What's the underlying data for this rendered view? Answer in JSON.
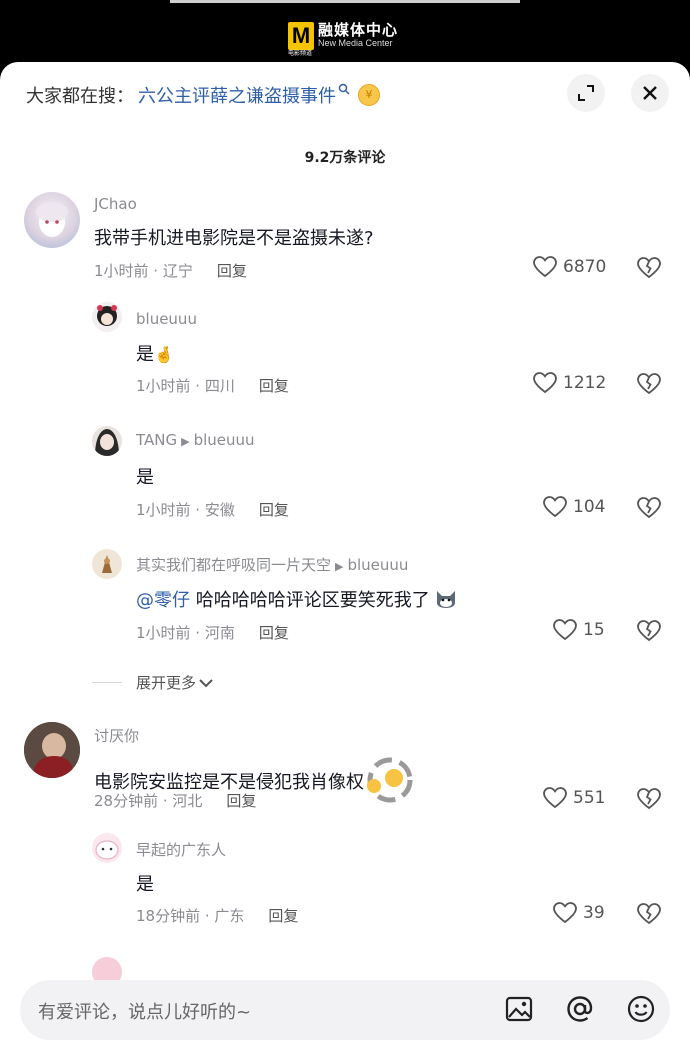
{
  "topbar": {
    "brand_cn": "融媒体中心",
    "brand_en": "New Media Center",
    "brand_sub": "电影频道",
    "logo_letter": "M"
  },
  "search_hint": {
    "label": "大家都在搜：",
    "keyword": "六公主评薛之谦盗摄事件",
    "coin": "¥"
  },
  "comment_count": "9.2万条评论",
  "comments": [
    {
      "user": "JChao",
      "text": "我带手机进电影院是不是盗摄未遂?",
      "time": "1小时前 · 辽宁",
      "reply": "回复",
      "likes": "6870"
    },
    {
      "user": "blueuuu",
      "text": "是",
      "time": "1小时前 · 四川",
      "reply": "回复",
      "likes": "1212",
      "emoji": "🤞"
    },
    {
      "user": "TANG",
      "reply_to": "blueuuu",
      "text": "是",
      "time": "1小时前 · 安徽",
      "reply": "回复",
      "likes": "104"
    },
    {
      "user": "其实我们都在呼吸同一片天空",
      "reply_to": "blueuuu",
      "mention": "@零仔",
      "text": "哈哈哈哈哈评论区要笑死我了",
      "time": "1小时前 · 河南",
      "reply": "回复",
      "likes": "15"
    },
    {
      "user": "讨厌你",
      "text": "电影院安监控是不是侵犯我肖像权",
      "time": "28分钟前 · 河北",
      "reply": "回复",
      "likes": "551"
    },
    {
      "user": "早起的广东人",
      "text": "是",
      "time": "18分钟前 · 广东",
      "reply": "回复",
      "likes": "39"
    }
  ],
  "expand_more": "展开更多",
  "input": {
    "placeholder": "有爱评论，说点儿好听的~"
  },
  "icons": [
    "expand-icon",
    "close-icon",
    "heart-icon",
    "broken-heart-icon",
    "image-icon",
    "at-icon",
    "emoji-icon"
  ]
}
